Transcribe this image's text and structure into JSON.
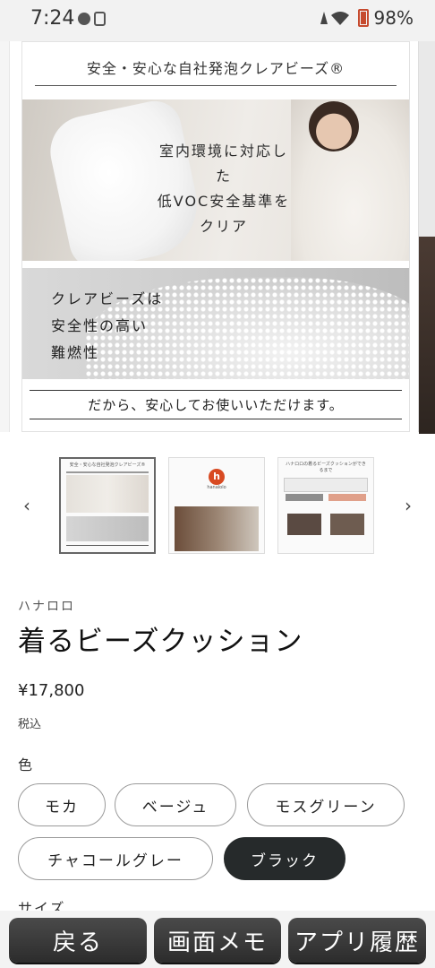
{
  "status_bar": {
    "time": "7:24",
    "battery": "98%"
  },
  "hero": {
    "title": "安全・安心な自社発泡クレアビーズ®",
    "photo1_lines": [
      "室内環境に対応した",
      "低VOC安全基準を",
      "クリア"
    ],
    "photo2_lines": [
      "クレアビーズは",
      "安全性の高い",
      "難燃性"
    ],
    "bottom_text": "だから、安心してお使いいただけます。"
  },
  "thumbnails": {
    "prev_icon": "chevron-left-icon",
    "next_icon": "chevron-right-icon",
    "items": [
      {
        "label": "安全・安心な自社発泡クレアビーズ®",
        "active": true
      },
      {
        "label": "hanalolo",
        "active": false
      },
      {
        "label": "ハナロロの着るビーズクッションができるまで",
        "active": false
      }
    ]
  },
  "product": {
    "brand": "ハナロロ",
    "title": "着るビーズクッション",
    "price": "¥17,800",
    "tax": "税込",
    "color_label": "色",
    "colors": [
      "モカ",
      "ベージュ",
      "モスグリーン",
      "チャコールグレー",
      "ブラック"
    ],
    "selected_color": "ブラック",
    "size_label": "サイズ"
  },
  "bottom_nav": {
    "back": "戻る",
    "memo": "画面メモ",
    "history": "アプリ履歴"
  }
}
